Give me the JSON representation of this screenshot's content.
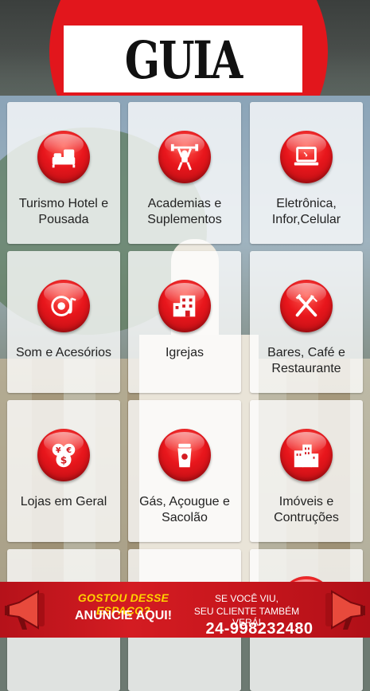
{
  "header": {
    "logo_text": "GUIA PARATY"
  },
  "categories": [
    {
      "label": "Turismo Hotel e Pousada",
      "icon": "bed-icon"
    },
    {
      "label": "Academias e Suplementos",
      "icon": "weightlifter-icon"
    },
    {
      "label": "Eletrônica, Infor,Celular",
      "icon": "laptop-icon"
    },
    {
      "label": "Som e Acesórios",
      "icon": "speaker-music-icon"
    },
    {
      "label": "Igrejas",
      "icon": "building-icon"
    },
    {
      "label": "Bares, Café e Restaurante",
      "icon": "fork-knife-icon"
    },
    {
      "label": "Lojas em Geral",
      "icon": "money-bag-icon"
    },
    {
      "label": "Gás, Açougue e Sacolão",
      "icon": "cup-icon"
    },
    {
      "label": "Imóveis e Contruções",
      "icon": "city-buildings-icon"
    }
  ],
  "banner": {
    "question": "GOSTOU DESSE ESPAÇO?",
    "cta": "ANUNCIE AQUI!",
    "slogan_line1": "SE VOCÊ VIU,",
    "slogan_line2": "SEU CLIENTE TAMBÉM VERÁ!",
    "phone": "24-998232480"
  },
  "colors": {
    "accent": "#e2161c",
    "banner": "#c5151c",
    "banner_highlight": "#ffd200"
  }
}
